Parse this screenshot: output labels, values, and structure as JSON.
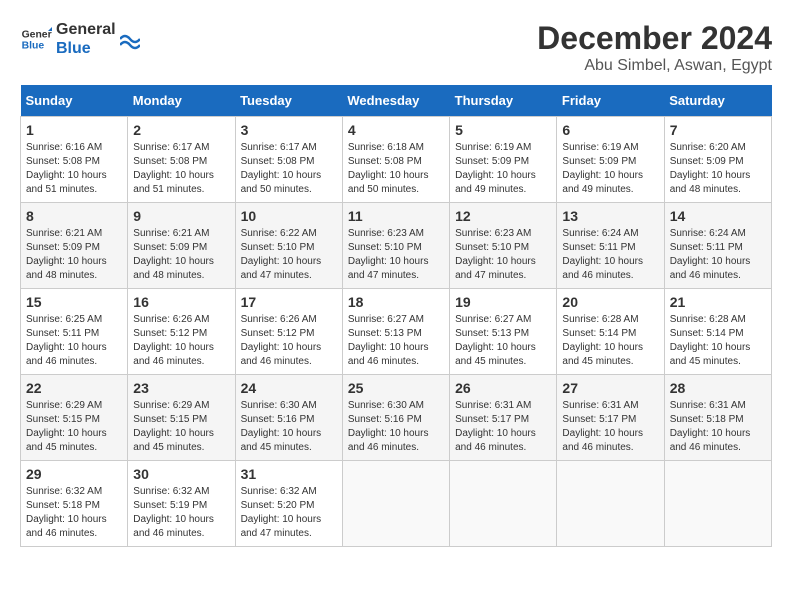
{
  "logo": {
    "line1": "General",
    "line2": "Blue"
  },
  "title": "December 2024",
  "location": "Abu Simbel, Aswan, Egypt",
  "days_of_week": [
    "Sunday",
    "Monday",
    "Tuesday",
    "Wednesday",
    "Thursday",
    "Friday",
    "Saturday"
  ],
  "weeks": [
    [
      {
        "day": "1",
        "sunrise": "6:16 AM",
        "sunset": "5:08 PM",
        "daylight": "10 hours and 51 minutes."
      },
      {
        "day": "2",
        "sunrise": "6:17 AM",
        "sunset": "5:08 PM",
        "daylight": "10 hours and 51 minutes."
      },
      {
        "day": "3",
        "sunrise": "6:17 AM",
        "sunset": "5:08 PM",
        "daylight": "10 hours and 50 minutes."
      },
      {
        "day": "4",
        "sunrise": "6:18 AM",
        "sunset": "5:08 PM",
        "daylight": "10 hours and 50 minutes."
      },
      {
        "day": "5",
        "sunrise": "6:19 AM",
        "sunset": "5:09 PM",
        "daylight": "10 hours and 49 minutes."
      },
      {
        "day": "6",
        "sunrise": "6:19 AM",
        "sunset": "5:09 PM",
        "daylight": "10 hours and 49 minutes."
      },
      {
        "day": "7",
        "sunrise": "6:20 AM",
        "sunset": "5:09 PM",
        "daylight": "10 hours and 48 minutes."
      }
    ],
    [
      {
        "day": "8",
        "sunrise": "6:21 AM",
        "sunset": "5:09 PM",
        "daylight": "10 hours and 48 minutes."
      },
      {
        "day": "9",
        "sunrise": "6:21 AM",
        "sunset": "5:09 PM",
        "daylight": "10 hours and 48 minutes."
      },
      {
        "day": "10",
        "sunrise": "6:22 AM",
        "sunset": "5:10 PM",
        "daylight": "10 hours and 47 minutes."
      },
      {
        "day": "11",
        "sunrise": "6:23 AM",
        "sunset": "5:10 PM",
        "daylight": "10 hours and 47 minutes."
      },
      {
        "day": "12",
        "sunrise": "6:23 AM",
        "sunset": "5:10 PM",
        "daylight": "10 hours and 47 minutes."
      },
      {
        "day": "13",
        "sunrise": "6:24 AM",
        "sunset": "5:11 PM",
        "daylight": "10 hours and 46 minutes."
      },
      {
        "day": "14",
        "sunrise": "6:24 AM",
        "sunset": "5:11 PM",
        "daylight": "10 hours and 46 minutes."
      }
    ],
    [
      {
        "day": "15",
        "sunrise": "6:25 AM",
        "sunset": "5:11 PM",
        "daylight": "10 hours and 46 minutes."
      },
      {
        "day": "16",
        "sunrise": "6:26 AM",
        "sunset": "5:12 PM",
        "daylight": "10 hours and 46 minutes."
      },
      {
        "day": "17",
        "sunrise": "6:26 AM",
        "sunset": "5:12 PM",
        "daylight": "10 hours and 46 minutes."
      },
      {
        "day": "18",
        "sunrise": "6:27 AM",
        "sunset": "5:13 PM",
        "daylight": "10 hours and 46 minutes."
      },
      {
        "day": "19",
        "sunrise": "6:27 AM",
        "sunset": "5:13 PM",
        "daylight": "10 hours and 45 minutes."
      },
      {
        "day": "20",
        "sunrise": "6:28 AM",
        "sunset": "5:14 PM",
        "daylight": "10 hours and 45 minutes."
      },
      {
        "day": "21",
        "sunrise": "6:28 AM",
        "sunset": "5:14 PM",
        "daylight": "10 hours and 45 minutes."
      }
    ],
    [
      {
        "day": "22",
        "sunrise": "6:29 AM",
        "sunset": "5:15 PM",
        "daylight": "10 hours and 45 minutes."
      },
      {
        "day": "23",
        "sunrise": "6:29 AM",
        "sunset": "5:15 PM",
        "daylight": "10 hours and 45 minutes."
      },
      {
        "day": "24",
        "sunrise": "6:30 AM",
        "sunset": "5:16 PM",
        "daylight": "10 hours and 45 minutes."
      },
      {
        "day": "25",
        "sunrise": "6:30 AM",
        "sunset": "5:16 PM",
        "daylight": "10 hours and 46 minutes."
      },
      {
        "day": "26",
        "sunrise": "6:31 AM",
        "sunset": "5:17 PM",
        "daylight": "10 hours and 46 minutes."
      },
      {
        "day": "27",
        "sunrise": "6:31 AM",
        "sunset": "5:17 PM",
        "daylight": "10 hours and 46 minutes."
      },
      {
        "day": "28",
        "sunrise": "6:31 AM",
        "sunset": "5:18 PM",
        "daylight": "10 hours and 46 minutes."
      }
    ],
    [
      {
        "day": "29",
        "sunrise": "6:32 AM",
        "sunset": "5:18 PM",
        "daylight": "10 hours and 46 minutes."
      },
      {
        "day": "30",
        "sunrise": "6:32 AM",
        "sunset": "5:19 PM",
        "daylight": "10 hours and 46 minutes."
      },
      {
        "day": "31",
        "sunrise": "6:32 AM",
        "sunset": "5:20 PM",
        "daylight": "10 hours and 47 minutes."
      },
      null,
      null,
      null,
      null
    ]
  ]
}
